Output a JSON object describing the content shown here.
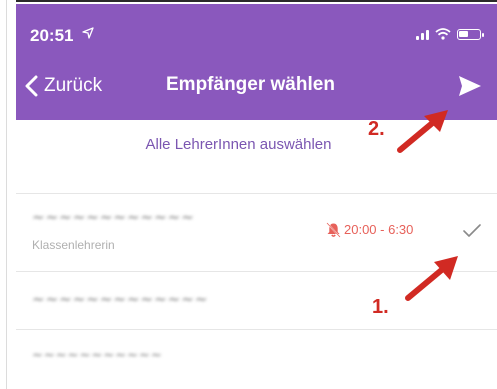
{
  "status_bar": {
    "time": "20:51",
    "location_icon": "location-arrow-icon",
    "signal_icon": "signal-bars-icon",
    "wifi_icon": "wifi-icon",
    "battery_icon": "battery-icon"
  },
  "nav": {
    "back_label": "Zurück",
    "title": "Empfänger wählen",
    "send_icon": "send-icon"
  },
  "actions": {
    "select_all_label": "Alle LehrerInnen auswählen"
  },
  "recipients": [
    {
      "name": "~~~~~~~~~~~~",
      "role": "Klassenlehrerin",
      "quiet_hours": "20:00 - 6:30",
      "selected": true
    },
    {
      "name": "~~~~~~~~~~~~~",
      "role": "",
      "quiet_hours": "",
      "selected": false
    },
    {
      "name": "~~~~~~~~~~~",
      "role": "",
      "quiet_hours": "",
      "selected": false
    }
  ],
  "annotations": {
    "label_1": "1.",
    "label_2": "2."
  },
  "colors": {
    "header": "#8a58bd",
    "accent_text": "#7b56b1",
    "quiet_hours": "#e7615a",
    "annotation": "#d12a23"
  }
}
